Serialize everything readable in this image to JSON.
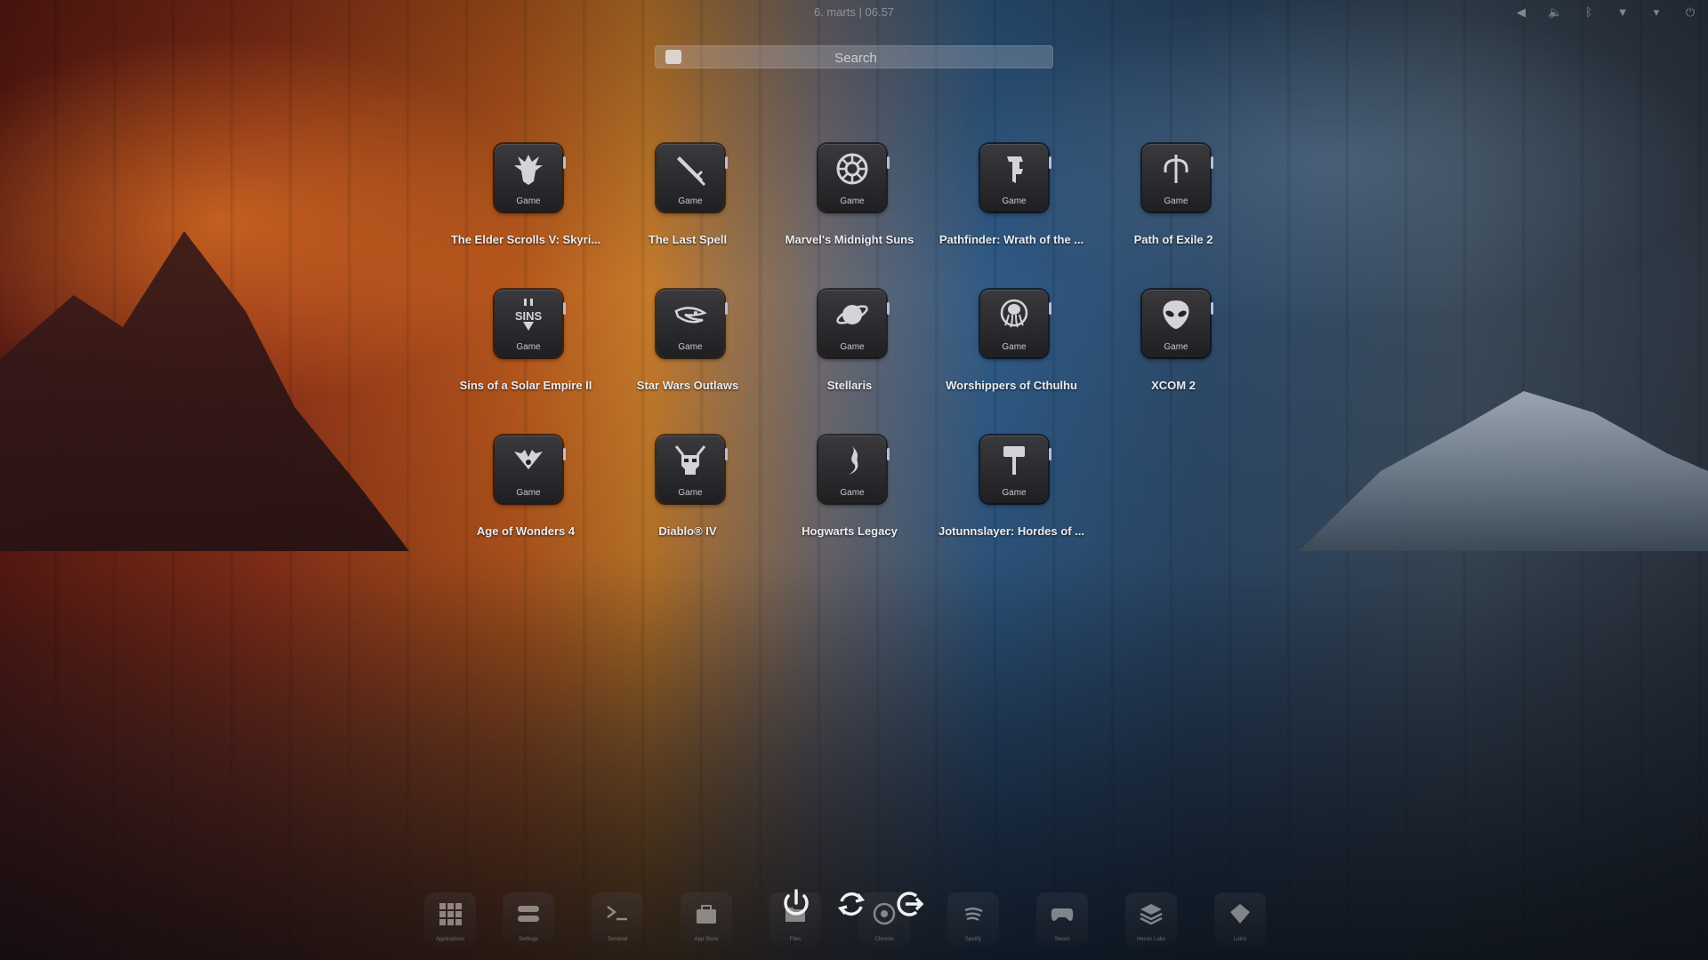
{
  "topbar": {
    "clock": "6. marts | 06.57",
    "tray_icons": [
      "volume-down-icon",
      "volume-icon",
      "bluetooth-icon",
      "wifi-icon",
      "dropdown-icon",
      "power-menu-icon"
    ]
  },
  "search": {
    "placeholder": "Search"
  },
  "apps": [
    {
      "name": "The Elder Scrolls V: Skyri...",
      "category": "Game",
      "icon": "dragon-icon"
    },
    {
      "name": "The Last Spell",
      "category": "Game",
      "icon": "sword-icon"
    },
    {
      "name": "Marvel's Midnight Suns",
      "category": "Game",
      "icon": "sun-emblem-icon"
    },
    {
      "name": "Pathfinder: Wrath of the ...",
      "category": "Game",
      "icon": "pathfinder-icon"
    },
    {
      "name": "Path of Exile 2",
      "category": "Game",
      "icon": "trident-icon"
    },
    {
      "name": "Sins of a Solar Empire II",
      "category": "Game",
      "icon": "sins-logo-icon"
    },
    {
      "name": "Star Wars Outlaws",
      "category": "Game",
      "icon": "outlaws-icon"
    },
    {
      "name": "Stellaris",
      "category": "Game",
      "icon": "planet-icon"
    },
    {
      "name": "Worshippers of Cthulhu",
      "category": "Game",
      "icon": "cthulhu-icon"
    },
    {
      "name": "XCOM 2",
      "category": "Game",
      "icon": "alien-icon"
    },
    {
      "name": "Age of Wonders 4",
      "category": "Game",
      "icon": "wings-icon"
    },
    {
      "name": "Diablo® IV",
      "category": "Game",
      "icon": "skull-icon"
    },
    {
      "name": "Hogwarts Legacy",
      "category": "Game",
      "icon": "flame-icon"
    },
    {
      "name": "Jotunnslayer: Hordes of ...",
      "category": "Game",
      "icon": "hammer-icon"
    }
  ],
  "dock": {
    "items": [
      {
        "label": "Applications",
        "icon": "grid-icon"
      },
      {
        "label": "Settings",
        "icon": "toggles-icon"
      },
      {
        "label": "Terminal",
        "icon": "terminal-icon"
      },
      {
        "label": "App Store",
        "icon": "bag-icon"
      },
      {
        "label": "Files",
        "icon": "folder-icon"
      },
      {
        "label": "Chrome",
        "icon": "browser-icon"
      },
      {
        "label": "Spotify",
        "icon": "spotify-icon"
      },
      {
        "label": "Steam",
        "icon": "gamepad-icon"
      },
      {
        "label": "Heroic Labs",
        "icon": "layers-icon"
      },
      {
        "label": "Lutris",
        "icon": "lutris-icon"
      }
    ],
    "session_buttons": [
      "power-icon",
      "restart-icon",
      "logout-icon"
    ]
  },
  "colors": {
    "pip": "#b8bcd8",
    "tile": "#2a2a2e"
  }
}
